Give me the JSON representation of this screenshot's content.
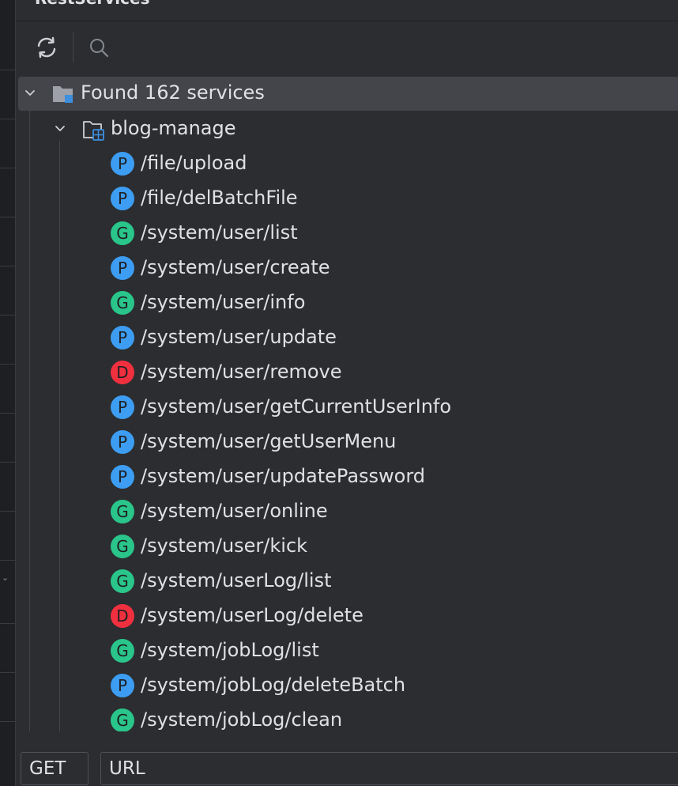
{
  "panel": {
    "title": "RestServices"
  },
  "toolbar": {
    "refresh_icon": "refresh-icon",
    "search_icon": "search-icon"
  },
  "colors": {
    "post": "#3d9df2",
    "get": "#2ac58a",
    "delete": "#f0303f"
  },
  "tree": {
    "root_label": "Found 162 services",
    "module_label": "blog-manage",
    "services": [
      {
        "method": "POST",
        "badge": "P",
        "path": "/file/upload"
      },
      {
        "method": "POST",
        "badge": "P",
        "path": "/file/delBatchFile"
      },
      {
        "method": "GET",
        "badge": "G",
        "path": "/system/user/list"
      },
      {
        "method": "POST",
        "badge": "P",
        "path": "/system/user/create"
      },
      {
        "method": "GET",
        "badge": "G",
        "path": "/system/user/info"
      },
      {
        "method": "POST",
        "badge": "P",
        "path": "/system/user/update"
      },
      {
        "method": "DELETE",
        "badge": "D",
        "path": "/system/user/remove"
      },
      {
        "method": "POST",
        "badge": "P",
        "path": "/system/user/getCurrentUserInfo"
      },
      {
        "method": "POST",
        "badge": "P",
        "path": "/system/user/getUserMenu"
      },
      {
        "method": "POST",
        "badge": "P",
        "path": "/system/user/updatePassword"
      },
      {
        "method": "GET",
        "badge": "G",
        "path": "/system/user/online"
      },
      {
        "method": "GET",
        "badge": "G",
        "path": "/system/user/kick"
      },
      {
        "method": "GET",
        "badge": "G",
        "path": "/system/userLog/list"
      },
      {
        "method": "DELETE",
        "badge": "D",
        "path": "/system/userLog/delete"
      },
      {
        "method": "GET",
        "badge": "G",
        "path": "/system/jobLog/list"
      },
      {
        "method": "POST",
        "badge": "P",
        "path": "/system/jobLog/deleteBatch"
      },
      {
        "method": "GET",
        "badge": "G",
        "path": "/system/jobLog/clean"
      }
    ]
  },
  "request": {
    "method_value": "GET",
    "url_value": "URL"
  }
}
